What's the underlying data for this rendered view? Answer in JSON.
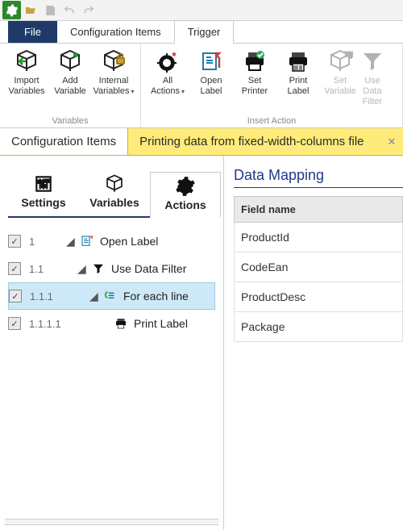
{
  "qat": {},
  "tabs": {
    "file": "File",
    "items": [
      {
        "label": "Configuration Items"
      },
      {
        "label": "Trigger",
        "active": true
      }
    ]
  },
  "ribbon": {
    "groups": [
      {
        "label": "Variables",
        "buttons": [
          {
            "label": "Import\nVariables",
            "icon": "import",
            "dd": false
          },
          {
            "label": "Add\nVariable",
            "icon": "add",
            "dd": false
          },
          {
            "label": "Internal\nVariables",
            "icon": "lock",
            "dd": true
          }
        ]
      },
      {
        "label": "Insert Action",
        "buttons": [
          {
            "label": "All\nActions",
            "icon": "gear-star",
            "dd": true
          },
          {
            "label": "Open\nLabel",
            "icon": "open-label",
            "dd": false
          },
          {
            "label": "Set\nPrinter",
            "icon": "set-printer",
            "dd": false
          },
          {
            "label": "Print\nLabel",
            "icon": "print-label",
            "dd": false
          },
          {
            "label": "Set\nVariable",
            "icon": "set-variable",
            "dd": false,
            "disabled": true
          },
          {
            "label": "Use Data\nFilter",
            "icon": "filter",
            "dd": false,
            "disabled": true
          }
        ]
      }
    ]
  },
  "subtabs": {
    "items": [
      {
        "label": "Configuration Items",
        "active": true
      },
      {
        "label": "Printing data from fixed-width-columns file"
      }
    ]
  },
  "leftTabs": [
    {
      "label": "Settings",
      "icon": "sliders"
    },
    {
      "label": "Variables",
      "icon": "cube"
    },
    {
      "label": "Actions",
      "icon": "gear",
      "active": true
    }
  ],
  "tree": [
    {
      "num": "1",
      "label": "Open Label",
      "icon": "open-label",
      "indent": 0
    },
    {
      "num": "1.1",
      "label": "Use Data Filter",
      "icon": "filter",
      "indent": 1
    },
    {
      "num": "1.1.1",
      "label": "For each line",
      "icon": "foreach",
      "indent": 2,
      "selected": true
    },
    {
      "num": "1.1.1.1",
      "label": "Print Label",
      "icon": "print-label",
      "indent": 3
    }
  ],
  "dataMapping": {
    "title": "Data Mapping",
    "header": "Field name",
    "rows": [
      "ProductId",
      "CodeEan",
      "ProductDesc",
      "Package"
    ]
  }
}
